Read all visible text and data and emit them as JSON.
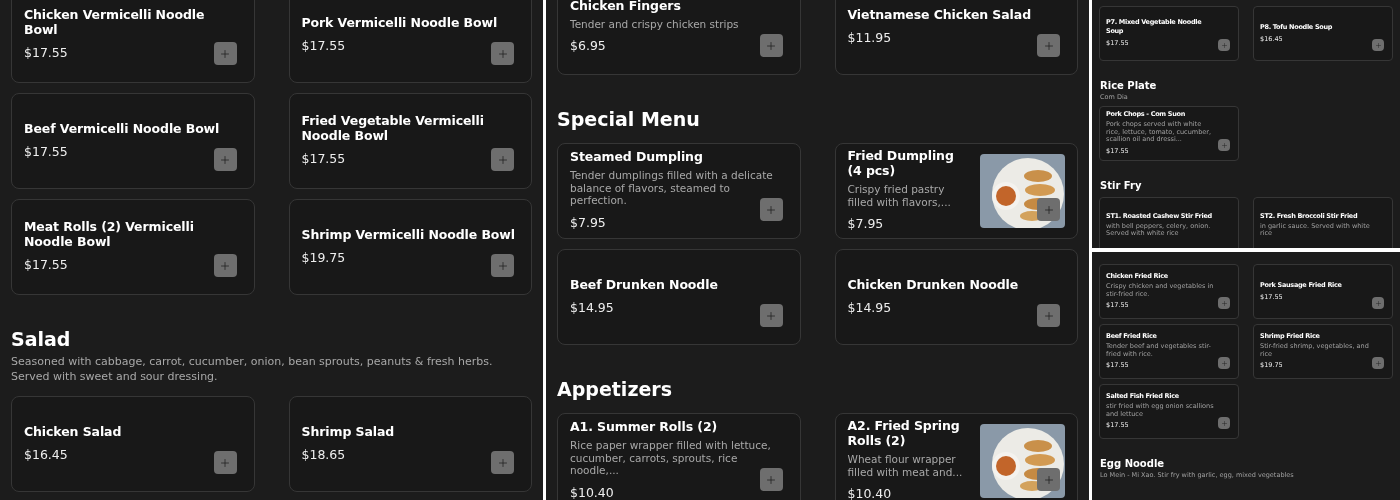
{
  "columns": [
    {
      "views": [
        {
          "sections": [
            {
              "items": [
                {
                  "kind": "plain",
                  "name": "Chicken Vermicelli Noodle Bowl",
                  "price": "$17.55"
                },
                {
                  "kind": "plain",
                  "name": "Pork Vermicelli Noodle Bowl",
                  "price": "$17.55"
                },
                {
                  "kind": "plain",
                  "name": "Beef Vermicelli Noodle Bowl",
                  "price": "$17.55"
                },
                {
                  "kind": "plain",
                  "name": "Fried Vegetable Vermicelli Noodle Bowl",
                  "price": "$17.55"
                },
                {
                  "kind": "plain",
                  "name": "Meat Rolls (2) Vermicelli Noodle Bowl",
                  "price": "$17.55"
                },
                {
                  "kind": "plain",
                  "name": "Shrimp Vermicelli Noodle Bowl",
                  "price": "$19.75"
                }
              ]
            },
            {
              "title": "Salad",
              "subtitle": "Seasoned with cabbage, carrot, cucumber, onion, bean sprouts, peanuts & fresh herbs. Served with sweet and sour dressing.",
              "items": [
                {
                  "kind": "plain",
                  "name": "Chicken Salad",
                  "price": "$16.45"
                },
                {
                  "kind": "plain",
                  "name": "Shrimp Salad",
                  "price": "$18.65"
                }
              ]
            }
          ]
        }
      ]
    },
    {
      "views": [
        {
          "sections": [
            {
              "items": [
                {
                  "kind": "plain",
                  "name": "Chicken Fingers",
                  "description": "Tender and crispy chicken strips",
                  "price": "$6.95"
                },
                {
                  "kind": "plain",
                  "name": "Vietnamese Chicken Salad",
                  "price": "$11.95"
                }
              ]
            },
            {
              "title": "Special Menu",
              "items": [
                {
                  "kind": "plain",
                  "name": "Steamed Dumpling",
                  "description": "Tender dumplings filled with a delicate balance of flavors, steamed to perfection.",
                  "price": "$7.95"
                },
                {
                  "kind": "picture",
                  "name": "Fried Dumpling (4 pcs)",
                  "description": "Crispy fried pastry filled with flavors,...",
                  "price": "$7.95"
                },
                {
                  "kind": "plain",
                  "name": "Beef Drunken Noodle",
                  "price": "$14.95"
                },
                {
                  "kind": "plain",
                  "name": "Chicken Drunken Noodle",
                  "price": "$14.95"
                }
              ]
            },
            {
              "title": "Appetizers",
              "items": [
                {
                  "kind": "plain",
                  "name": "A1. Summer Rolls (2)",
                  "description": "Rice paper wrapper filled with lettuce, cucumber, carrots, sprouts, rice noodle,...",
                  "price": "$10.40"
                },
                {
                  "kind": "picture",
                  "name": "A2. Fried Spring Rolls (2)",
                  "description": "Wheat flour wrapper filled with meat and...",
                  "price": "$10.40"
                }
              ]
            }
          ]
        }
      ]
    },
    {
      "views": [
        {
          "sections": [
            {
              "items": [
                {
                  "kind": "plain",
                  "name": "P7. Mixed Vegetable Noodle Soup",
                  "price": "$17.55"
                },
                {
                  "kind": "plain",
                  "name": "P8. Tofu Noodle Soup",
                  "price": "$16.45"
                }
              ]
            },
            {
              "title": "Rice Plate",
              "subtitle": "Com Dia",
              "items": [
                {
                  "kind": "plain",
                  "name": "Pork Chops - Com Suon",
                  "description": "Pork chops served with white rice, lettuce, tomato, cucumber, scallion oil and dressi...",
                  "price": "$17.55"
                }
              ]
            },
            {
              "title": "Stir Fry",
              "items": [
                {
                  "kind": "plain",
                  "name": "ST1. Roasted Cashew Stir Fried",
                  "description": "with bell peppers, celery, onion. Served with white rice"
                },
                {
                  "kind": "plain",
                  "name": "ST2. Fresh Broccoli Stir Fried",
                  "description": "in garlic sauce. Served with white rice"
                }
              ]
            }
          ]
        },
        {
          "sections": [
            {
              "items": [
                {
                  "kind": "plain",
                  "name": "Chicken Fried Rice",
                  "description": "Crispy chicken and vegetables in stir-fried rice.",
                  "price": "$17.55"
                },
                {
                  "kind": "plain",
                  "name": "Pork Sausage Fried Rice",
                  "price": "$17.55"
                },
                {
                  "kind": "plain",
                  "name": "Beef Fried Rice",
                  "description": "Tender beef and vegetables stir-fried with rice.",
                  "price": "$17.55"
                },
                {
                  "kind": "plain",
                  "name": "Shrimp Fried Rice",
                  "description": "Stir-fried shrimp, vegetables, and rice",
                  "price": "$19.75"
                },
                {
                  "kind": "plain",
                  "name": "Salted Fish Fried Rice",
                  "description": "stir fried with egg onion scallions and lettuce",
                  "price": "$17.55"
                }
              ]
            },
            {
              "title": "Egg Noodle",
              "subtitle": "Lo Mein - Mi Xao. Stir fry with garlic, egg, mixed vegetables"
            }
          ]
        }
      ]
    }
  ]
}
